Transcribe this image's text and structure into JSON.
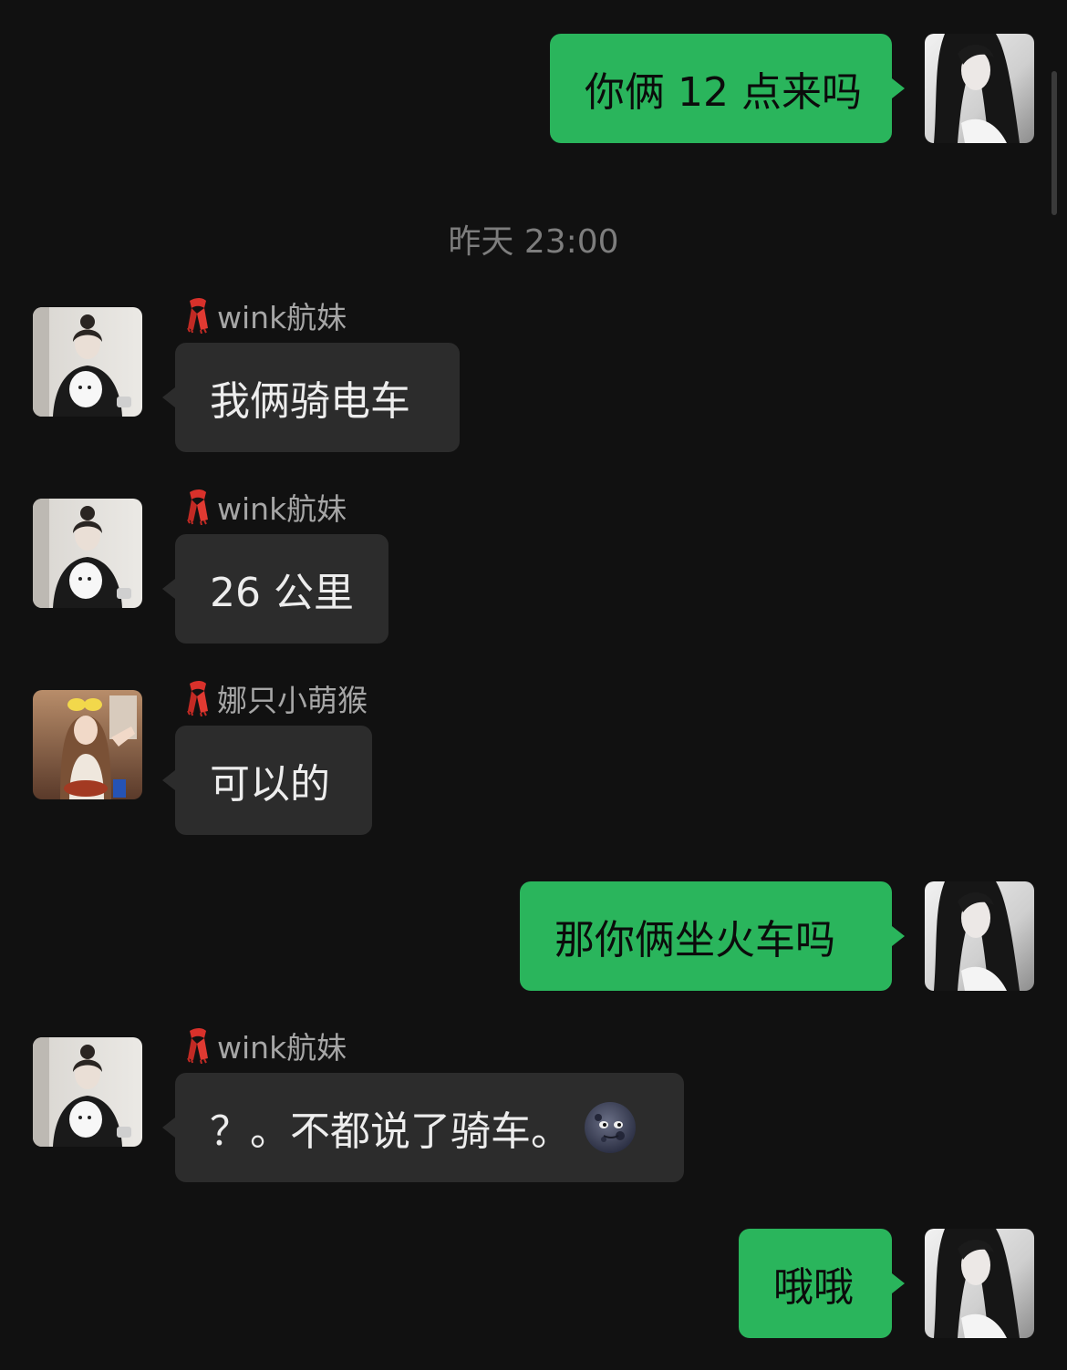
{
  "timestamp": "昨天 23:00",
  "messages": [
    {
      "direction": "out",
      "text": "你俩 12 点来吗"
    },
    {
      "direction": "in",
      "sender": "wink航妹",
      "text": "我俩骑电车"
    },
    {
      "direction": "in",
      "sender": "wink航妹",
      "text": "26 公里"
    },
    {
      "direction": "in",
      "sender": "娜只小萌猴",
      "text": "可以的"
    },
    {
      "direction": "out",
      "text": "那你俩坐火车吗"
    },
    {
      "direction": "in",
      "sender": "wink航妹",
      "text": "？。不都说了骑车。",
      "emoji": "new-moon-face-emoji"
    },
    {
      "direction": "out",
      "text": "哦哦"
    }
  ],
  "sender_prefix_icon": "scarf-icon",
  "colors": {
    "background": "#111111",
    "outgoing_bubble": "#2ab55c",
    "incoming_bubble": "#2c2c2c",
    "sender_name": "#a6a6a6",
    "timestamp": "#7d7d7d"
  }
}
